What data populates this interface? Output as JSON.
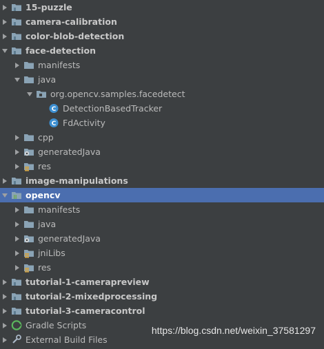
{
  "tree": [
    {
      "label": "15-puzzle",
      "type": "module",
      "expanded": false,
      "depth": 0
    },
    {
      "label": "camera-calibration",
      "type": "module",
      "expanded": false,
      "depth": 0
    },
    {
      "label": "color-blob-detection",
      "type": "module",
      "expanded": false,
      "depth": 0
    },
    {
      "label": "face-detection",
      "type": "module",
      "expanded": true,
      "depth": 0
    },
    {
      "label": "manifests",
      "type": "folder",
      "expanded": false,
      "depth": 1
    },
    {
      "label": "java",
      "type": "folder",
      "expanded": true,
      "depth": 1
    },
    {
      "label": "org.opencv.samples.facedetect",
      "type": "package",
      "expanded": true,
      "depth": 2
    },
    {
      "label": "DetectionBasedTracker",
      "type": "class",
      "depth": 3
    },
    {
      "label": "FdActivity",
      "type": "class",
      "depth": 3
    },
    {
      "label": "cpp",
      "type": "folder",
      "expanded": false,
      "depth": 1
    },
    {
      "label": "generatedJava",
      "type": "gen-folder",
      "expanded": false,
      "depth": 1
    },
    {
      "label": "res",
      "type": "res-folder",
      "expanded": false,
      "depth": 1
    },
    {
      "label": "image-manipulations",
      "type": "module",
      "expanded": false,
      "depth": 0
    },
    {
      "label": "opencv",
      "type": "library",
      "expanded": true,
      "depth": 0,
      "selected": true
    },
    {
      "label": "manifests",
      "type": "folder",
      "expanded": false,
      "depth": 1
    },
    {
      "label": "java",
      "type": "folder",
      "expanded": false,
      "depth": 1
    },
    {
      "label": "generatedJava",
      "type": "gen-folder",
      "expanded": false,
      "depth": 1
    },
    {
      "label": "jniLibs",
      "type": "res-folder",
      "expanded": false,
      "depth": 1
    },
    {
      "label": "res",
      "type": "res-folder",
      "expanded": false,
      "depth": 1
    },
    {
      "label": "tutorial-1-camerapreview",
      "type": "module",
      "expanded": false,
      "depth": 0
    },
    {
      "label": "tutorial-2-mixedprocessing",
      "type": "module",
      "expanded": false,
      "depth": 0
    },
    {
      "label": "tutorial-3-cameracontrol",
      "type": "module",
      "expanded": false,
      "depth": 0
    },
    {
      "label": "Gradle Scripts",
      "type": "gradle",
      "expanded": false,
      "depth": 0
    },
    {
      "label": "External Build Files",
      "type": "build",
      "expanded": false,
      "depth": 0
    }
  ],
  "watermark": "https://blog.csdn.net/weixin_37581297",
  "colors": {
    "background": "#3c3f41",
    "selection": "#4b6eaf",
    "folder": "#8aa3b5",
    "module_folder": "#87a0b3",
    "class_icon": "#3d8fd1"
  }
}
